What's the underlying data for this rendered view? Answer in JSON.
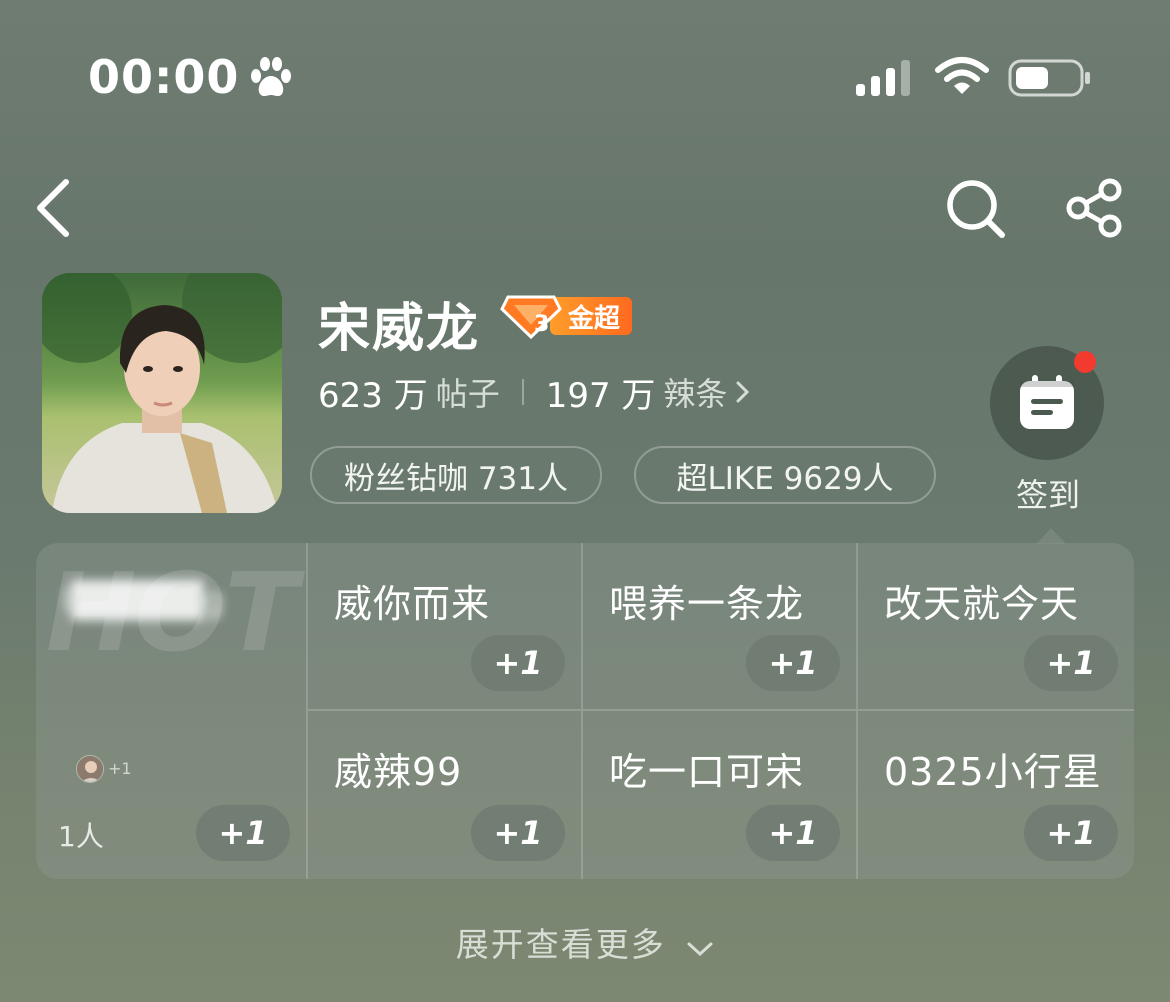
{
  "status_bar": {
    "time": "00:00"
  },
  "profile": {
    "name": "宋威龙",
    "badge_level": "3",
    "badge_label": "金超",
    "posts_count": "623 万",
    "posts_label": "帖子",
    "spicy_count": "197 万",
    "spicy_label": "辣条"
  },
  "pills": {
    "fans": "粉丝钻咖 731人",
    "like": "超LIKE 9629人"
  },
  "checkin": {
    "label": "签到"
  },
  "grid": {
    "hot": {
      "watermark": "HOT",
      "blurred_title": "I█████g",
      "mini_plus": "+1",
      "count": "1人",
      "plus": "+1"
    },
    "cells": [
      {
        "title": "威你而来",
        "plus": "+1"
      },
      {
        "title": "喂养一条龙",
        "plus": "+1"
      },
      {
        "title": "改天就今天",
        "plus": "+1"
      },
      {
        "title": "威辣99",
        "plus": "+1"
      },
      {
        "title": "吃一口可宋",
        "plus": "+1"
      },
      {
        "title": "0325小行星",
        "plus": "+1"
      }
    ]
  },
  "expand": {
    "label": "展开查看更多"
  },
  "colors": {
    "accent_orange": "#ff7a22",
    "notification_red": "#f23a2f"
  }
}
